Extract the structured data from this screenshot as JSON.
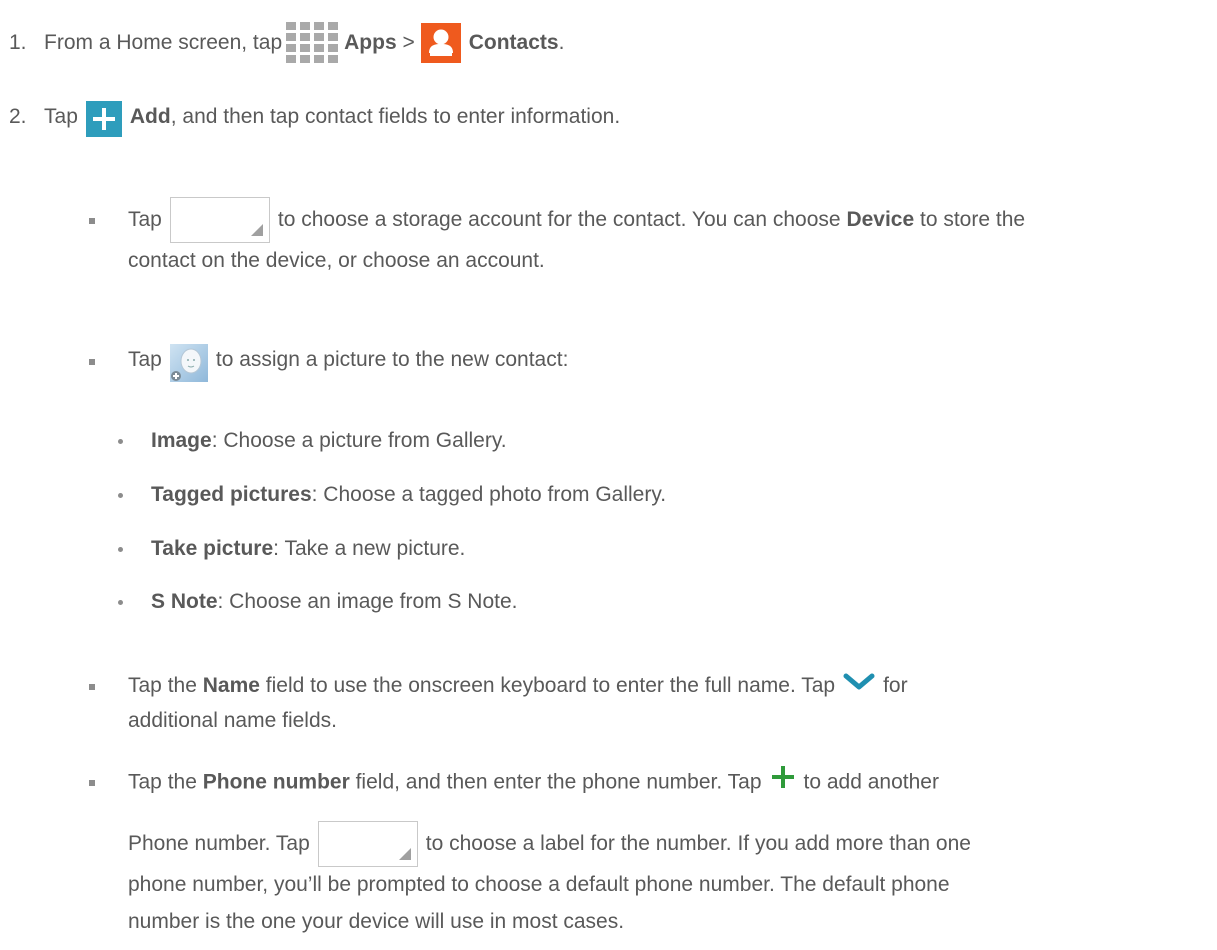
{
  "step1": {
    "number": "1.",
    "text_before": "From a Home screen, tap",
    "apps_label": "Apps",
    "separator": ">",
    "contacts_label": "Contacts",
    "end": "."
  },
  "step2": {
    "number": "2.",
    "tap": "Tap",
    "add_label": "Add",
    "text_after": ", and then tap contact fields to enter information."
  },
  "bullet_storage": {
    "tap": "Tap",
    "line1_after": "to choose a storage account for the contact. You can choose",
    "device_label": "Device",
    "line1_end": "to store the",
    "line2": "contact on the device, or choose an account."
  },
  "bullet_picture": {
    "tap": "Tap",
    "text_after": "to assign a picture to the new contact:",
    "options": [
      {
        "label": "Image",
        "desc": ": Choose a picture from Gallery."
      },
      {
        "label": "Tagged pictures",
        "desc": ": Choose a tagged photo from Gallery."
      },
      {
        "label": "Take picture",
        "desc": ": Take a new picture."
      },
      {
        "label": "S Note",
        "desc": ": Choose an image from S Note."
      }
    ]
  },
  "bullet_name": {
    "before": "Tap the",
    "field_label": "Name",
    "line1_after": "field to use the onscreen keyboard to enter the full name. Tap",
    "line1_end": "for",
    "line2": "additional name fields."
  },
  "bullet_phone": {
    "before": "Tap the",
    "field_label": "Phone number",
    "line1_after": "field, and then enter the phone number. Tap",
    "line1_end": "to add another",
    "line2_before": "Phone number. Tap",
    "line2_after": "to choose a label for the number. If you add more than one",
    "line3": "phone number, you’ll be prompted to choose a default phone number. The default phone",
    "line4": "number is the one your device will use in most cases."
  },
  "colors": {
    "text": "#595959",
    "contacts_icon": "#ef5a1e",
    "add_icon": "#2e9dbc",
    "chevron": "#1f8fb0",
    "plus_green": "#2f9a3a"
  }
}
